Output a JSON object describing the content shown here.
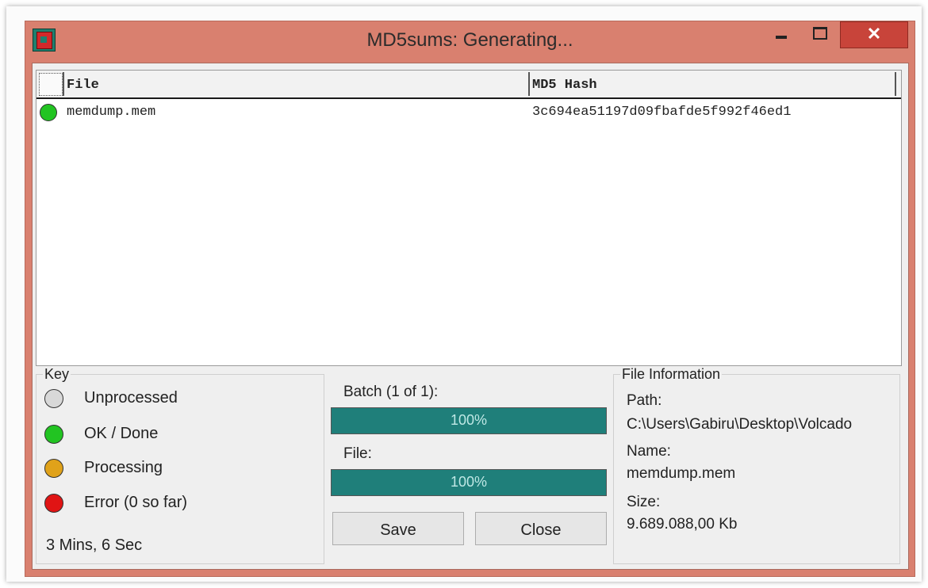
{
  "window": {
    "title": "MD5sums: Generating..."
  },
  "listview": {
    "columns": {
      "file": "File",
      "hash": "MD5 Hash"
    },
    "rows": [
      {
        "status": "green",
        "file": "memdump.mem",
        "hash": "3c694ea51197d09fbafde5f992f46ed1"
      }
    ]
  },
  "key": {
    "title": "Key",
    "items": [
      {
        "label": "Unprocessed",
        "color": "#d8d8d8"
      },
      {
        "label": "OK / Done",
        "color": "#22c422"
      },
      {
        "label": "Processing",
        "color": "#e0a21a"
      },
      {
        "label": "Error (0 so far)",
        "color": "#e01414"
      }
    ],
    "elapsed": "3 Mins, 6 Sec"
  },
  "batch": {
    "label": "Batch (1 of 1):",
    "percent_text": "100%",
    "progress": 1.0
  },
  "file_progress": {
    "label": "File:",
    "percent_text": "100%",
    "progress": 1.0
  },
  "buttons": {
    "save": "Save",
    "close": "Close"
  },
  "file_information": {
    "title": "File Information",
    "path_label": "Path:",
    "path_value": "C:\\Users\\Gabiru\\Desktop\\Volcado",
    "name_label": "Name:",
    "name_value": "memdump.mem",
    "size_label": "Size:",
    "size_value": "9.689.088,00 Kb"
  },
  "colors": {
    "titlebar": "#d9806f",
    "progress_fill": "#1f7f7a",
    "ok_green": "#22c422"
  }
}
